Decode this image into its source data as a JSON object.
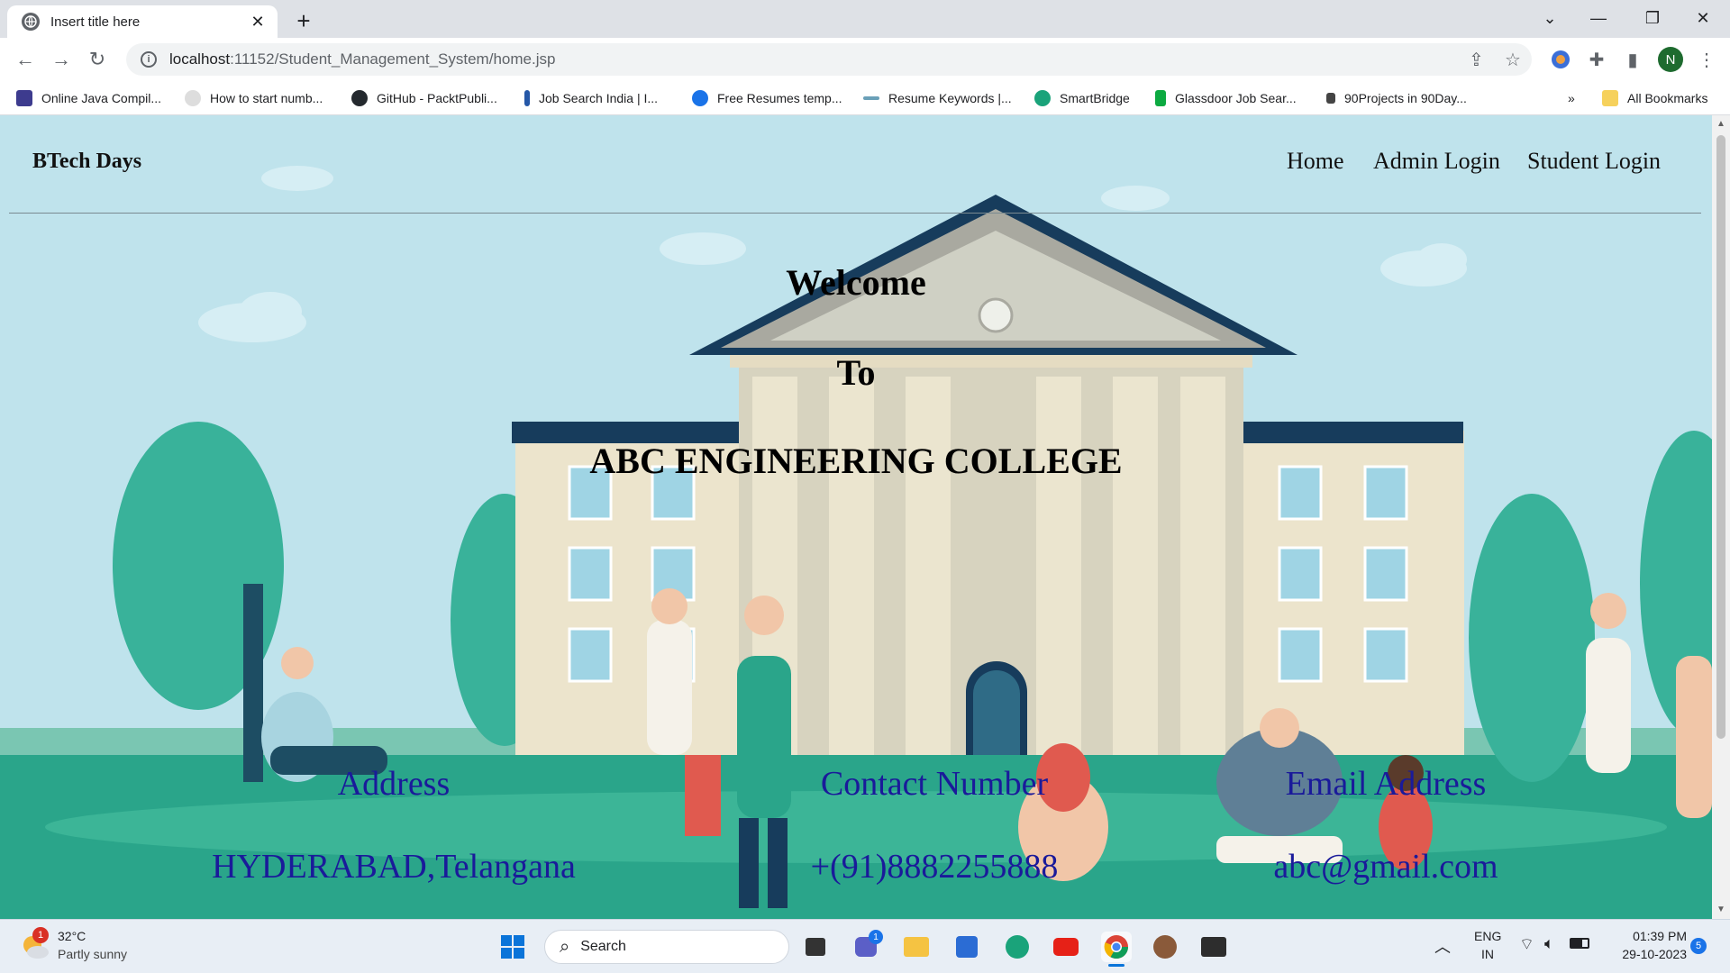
{
  "browser": {
    "tab_title": "Insert title here",
    "url_host": "localhost",
    "url_rest": ":11152/Student_Management_System/home.jsp",
    "profile_initial": "N",
    "bookmarks": [
      {
        "label": "Online Java Compil...",
        "color": "#3d3b8e"
      },
      {
        "label": "How to start numb...",
        "color": "#cccccc"
      },
      {
        "label": "GitHub - PacktPubli...",
        "color": "#24292e"
      },
      {
        "label": "Job Search India | I...",
        "color": "#2557a7"
      },
      {
        "label": "Free Resumes temp...",
        "color": "#1a73e8"
      },
      {
        "label": "Resume Keywords |...",
        "color": "#6aa0b8"
      },
      {
        "label": "SmartBridge",
        "color": "#1aa37a"
      },
      {
        "label": "Glassdoor Job Sear...",
        "color": "#0caa41"
      },
      {
        "label": "90Projects in 90Day...",
        "color": "#444444"
      }
    ],
    "all_bookmarks": "All Bookmarks",
    "more_bookmarks": "»"
  },
  "site": {
    "brand": "BTech Days",
    "nav": [
      "Home",
      "Admin Login",
      "Student Login"
    ],
    "welcome": "Welcome",
    "to": "To",
    "college": "ABC ENGINEERING COLLEGE",
    "address_label": "Address",
    "address_value": "HYDERABAD,Telangana",
    "contact_label": "Contact Number",
    "contact_value": "+(91)8882255888",
    "email_label": "Email Address",
    "email_value": "abc@gmail.com"
  },
  "taskbar": {
    "weather_temp": "32°C",
    "weather_desc": "Partly sunny",
    "weather_badge": "1",
    "search_label": "Search",
    "chat_badge": "1",
    "lang": "ENG",
    "region": "IN",
    "time": "01:39 PM",
    "date": "29-10-2023",
    "notif_count": "5"
  },
  "colors": {
    "accent_text": "#1a1a9a",
    "sky": "#bfe3ec",
    "lawn": "#2aa58a"
  }
}
